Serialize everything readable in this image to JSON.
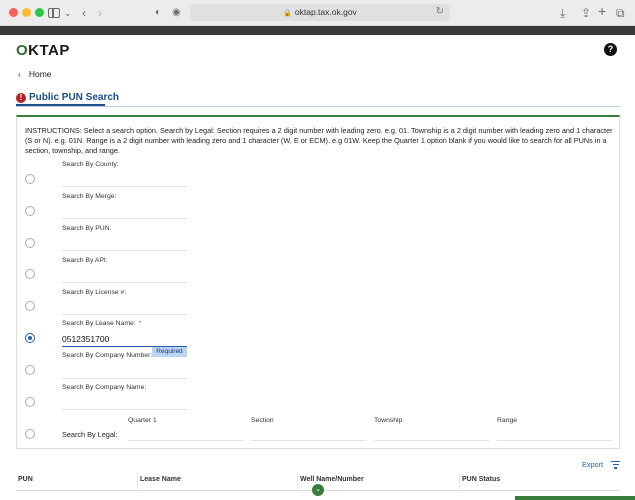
{
  "browser": {
    "url": "oktap.tax.ok.gov"
  },
  "header": {
    "logo_text": "OKTAP",
    "help_label": "?"
  },
  "nav": {
    "home_label": "Home"
  },
  "page": {
    "title": "Public PUN Search",
    "instructions": "INSTRUCTIONS: Select a search option. Search by Legal: Section requires a 2 digit number with leading zero. e.g. 01. Township is a 2 digit number with leading zero and 1 character (S or N). e.g. 01N. Range is a 2 digit number with leading zero and 1 character (W, E or ECM). e.g 01W. Keep the Quarter 1 option blank if you would like to search for all PUNs in a section, township, and range."
  },
  "search_options": [
    {
      "label": "Search By County:",
      "value": "",
      "selected": false
    },
    {
      "label": "Search By Merge:",
      "value": "",
      "selected": false
    },
    {
      "label": "Search By PUN:",
      "value": "",
      "selected": false
    },
    {
      "label": "Search By API:",
      "value": "",
      "selected": false
    },
    {
      "label": "Search By License #:",
      "value": "",
      "selected": false
    },
    {
      "label": "Search By Lease Name:",
      "value": "0512351700",
      "selected": true,
      "required": true,
      "badge": "Required"
    },
    {
      "label": "Search By Company Number:",
      "value": "",
      "selected": false
    },
    {
      "label": "Search By Company Name:",
      "value": "",
      "selected": false
    }
  ],
  "legal": {
    "label": "Search By Legal:",
    "columns": [
      "Quarter 1",
      "Section",
      "Township",
      "Range"
    ]
  },
  "results": {
    "export_label": "Export",
    "columns": [
      "PUN",
      "Lease Name",
      "Well Name/Number",
      "PUN Status"
    ]
  },
  "colors": {
    "brand_green": "#3a7d3a",
    "title_blue": "#1b4e8c",
    "link_blue": "#2a5db0"
  }
}
